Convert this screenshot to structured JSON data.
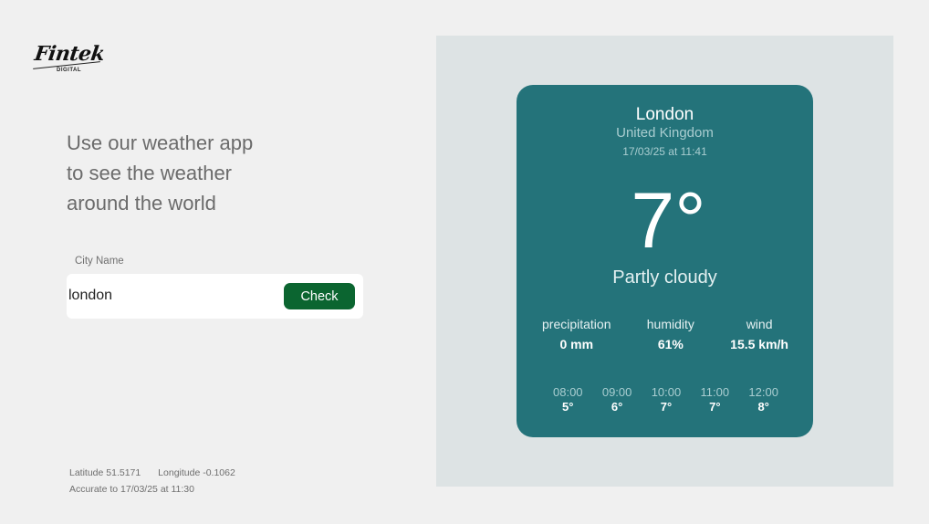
{
  "brand": {
    "name": "Fintek",
    "subtitle": "DIGITAL"
  },
  "intro": {
    "lines": [
      "Use our weather app",
      "to see the weather",
      "around the world"
    ]
  },
  "search": {
    "label": "City Name",
    "value": "london",
    "button_label": "Check"
  },
  "location": {
    "latitude_text": "Latitude 51.5171",
    "longitude_text": "Longitude -0.1062",
    "accuracy_text": "Accurate to 17/03/25 at 11:30"
  },
  "weather": {
    "city": "London",
    "country": "United Kingdom",
    "datetime": "17/03/25 at 11:41",
    "temperature": "7°",
    "condition": "Partly cloudy",
    "stats": [
      {
        "label": "precipitation",
        "value": "0 mm"
      },
      {
        "label": "humidity",
        "value": "61%"
      },
      {
        "label": "wind",
        "value": "15.5 km/h"
      }
    ],
    "hourly": [
      {
        "time": "08:00",
        "temp": "5°"
      },
      {
        "time": "09:00",
        "temp": "6°"
      },
      {
        "time": "10:00",
        "temp": "7°"
      },
      {
        "time": "11:00",
        "temp": "7°"
      },
      {
        "time": "12:00",
        "temp": "8°"
      }
    ]
  },
  "colors": {
    "background": "#f0f0f0",
    "panel": "#dde3e4",
    "card": "#24737a",
    "button": "#0b6530"
  }
}
